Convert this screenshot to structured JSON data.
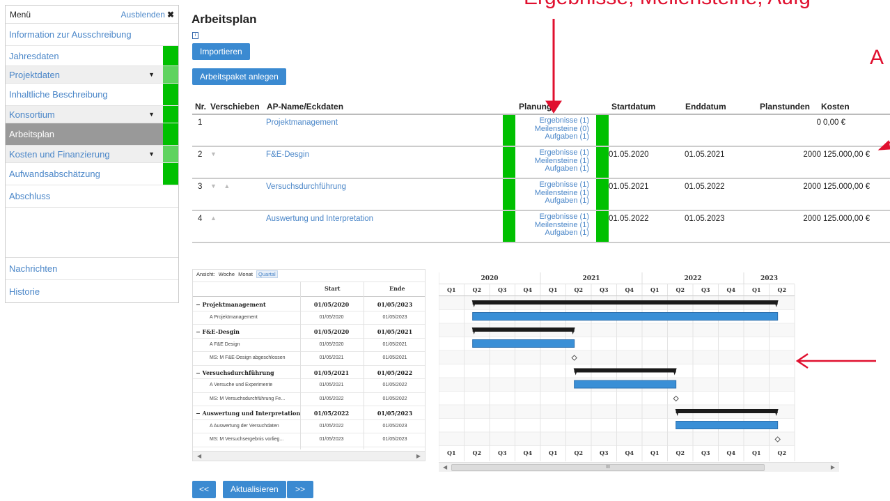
{
  "sidebar": {
    "header": "Menü",
    "hide_label": "Ausblenden",
    "hide_icon": "✖",
    "items": [
      {
        "label": "Information zur Ausschreibung"
      },
      {
        "label": "Jahresdaten"
      },
      {
        "label": "Projektdaten"
      },
      {
        "label": "Inhaltliche Beschreibung"
      },
      {
        "label": "Konsortium"
      },
      {
        "label": "Arbeitsplan"
      },
      {
        "label": "Kosten und Finanzierung"
      },
      {
        "label": "Aufwandsabschätzung"
      },
      {
        "label": "Abschluss"
      },
      {
        "label": "Nachrichten"
      },
      {
        "label": "Historie"
      }
    ],
    "status_color": "#00c000"
  },
  "page": {
    "title": "Arbeitsplan",
    "info_icon": "i",
    "import_button": "Importieren",
    "create_button": "Arbeitspaket anlegen"
  },
  "table": {
    "headers": {
      "nr": "Nr.",
      "move": "Verschieben",
      "name": "AP-Name/Eckdaten",
      "planning": "Planung",
      "start": "Startdatum",
      "end": "Enddatum",
      "hours": "Planstunden",
      "cost": "Kosten"
    },
    "rows": [
      {
        "nr": "1",
        "move": "",
        "name": "Projektmanagement",
        "res": "Ergebnisse (1)",
        "ms": "Meilensteine (0)",
        "tasks": "Aufgaben (1)",
        "start": "",
        "end": "",
        "hours": "0",
        "cost": "0,00 €"
      },
      {
        "nr": "2",
        "move": "▼",
        "name": "F&E-Desgin",
        "res": "Ergebnisse (1)",
        "ms": "Meilensteine (1)",
        "tasks": "Aufgaben (1)",
        "start": "01.05.2020",
        "end": "01.05.2021",
        "hours": "2000",
        "cost": "125.000,00 €"
      },
      {
        "nr": "3",
        "move": "▼ ▲",
        "name": "Versuchsdurchführung",
        "res": "Ergebnisse (1)",
        "ms": "Meilensteine (1)",
        "tasks": "Aufgaben (1)",
        "start": "01.05.2021",
        "end": "01.05.2022",
        "hours": "2000",
        "cost": "125.000,00 €"
      },
      {
        "nr": "4",
        "move": "▲",
        "name": "Auswertung und Interpretation",
        "res": "Ergebnisse (1)",
        "ms": "Meilensteine (1)",
        "tasks": "Aufgaben (1)",
        "start": "01.05.2022",
        "end": "01.05.2023",
        "hours": "2000",
        "cost": "125.000,00 €"
      }
    ]
  },
  "gantt": {
    "views": {
      "label": "Ansicht:",
      "week": "Woche",
      "month": "Monat",
      "quarter": "Quartal"
    },
    "col_start": "Start",
    "col_end": "Ende",
    "rows": [
      {
        "type": "group",
        "name": "− Projektmanagement",
        "start": "01/05/2020",
        "end": "01/05/2023"
      },
      {
        "type": "task",
        "name": "A  Projektmanagement",
        "start": "01/05/2020",
        "end": "01/05/2023"
      },
      {
        "type": "group",
        "name": "− F&E-Desgin",
        "start": "01/05/2020",
        "end": "01/05/2021"
      },
      {
        "type": "task",
        "name": "A  F&E Design",
        "start": "01/05/2020",
        "end": "01/05/2021"
      },
      {
        "type": "ms",
        "name": "MS: M  F&E-Design abgeschlossen",
        "start": "01/05/2021",
        "end": "01/05/2021"
      },
      {
        "type": "group",
        "name": "− Versuchsdurchführung",
        "start": "01/05/2021",
        "end": "01/05/2022"
      },
      {
        "type": "task",
        "name": "A  Versuche und Experimente",
        "start": "01/05/2021",
        "end": "01/05/2022"
      },
      {
        "type": "ms",
        "name": "MS: M  Versuchsdurchführung  Fe...",
        "start": "01/05/2022",
        "end": "01/05/2022"
      },
      {
        "type": "group",
        "name": "− Auswertung und Interpretation",
        "start": "01/05/2022",
        "end": "01/05/2023"
      },
      {
        "type": "task",
        "name": "A  Auswertung der Versuchdaten",
        "start": "01/05/2022",
        "end": "01/05/2023"
      },
      {
        "type": "ms",
        "name": "MS: M  Versuchsergebnis vorlieg...",
        "start": "01/05/2023",
        "end": "01/05/2023"
      }
    ],
    "years": [
      "2020",
      "2021",
      "2022",
      "2023"
    ],
    "quarters": [
      "Q1",
      "Q2",
      "Q3",
      "Q4",
      "Q1",
      "Q2",
      "Q3",
      "Q4",
      "Q1",
      "Q2",
      "Q3",
      "Q4",
      "Q1",
      "Q2"
    ],
    "timeline_start_quarter": "2020 Q1",
    "scroll_thumb_label": "III",
    "colors": {
      "group_bar": "#1a1a1a",
      "task_bar": "#3a8fd6"
    }
  },
  "pager": {
    "prev": "<<",
    "refresh": "Aktualisieren",
    "next": ">>"
  },
  "annotations": {
    "top_text": "Ergebnisse, Meilensteine, Aufg",
    "right_text": "A",
    "color": "#e0102f"
  }
}
